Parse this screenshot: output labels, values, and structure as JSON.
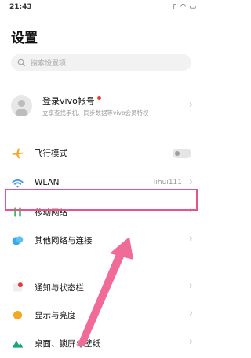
{
  "status": {
    "time": "21:43"
  },
  "header": {
    "title": "设置"
  },
  "search": {
    "placeholder": "搜索设置项"
  },
  "account": {
    "title": "登录vivo帐号",
    "subtitle": "立享查找手机、同步数据等vivo会员特权"
  },
  "items": [
    {
      "label": "飞行模式",
      "icon": "airplane-icon",
      "color": "#f5a623",
      "toggle": false
    },
    {
      "label": "WLAN",
      "icon": "wifi-icon",
      "color": "#3a8ef6",
      "value": "lihui111"
    },
    {
      "label": "移动网络",
      "icon": "mobile-network-icon",
      "color": "#2fbf5f"
    },
    {
      "label": "其他网络与连接",
      "icon": "connection-icon",
      "color": "#3aa7f0"
    },
    {
      "label": "通知与状态栏",
      "icon": "notification-icon",
      "color": "#e53935"
    },
    {
      "label": "显示与亮度",
      "icon": "brightness-icon",
      "color": "#f5a623"
    },
    {
      "label": "桌面、锁屏与壁纸",
      "icon": "wallpaper-icon",
      "color": "#1aa57a"
    }
  ],
  "highlight_color": "#e8548a"
}
